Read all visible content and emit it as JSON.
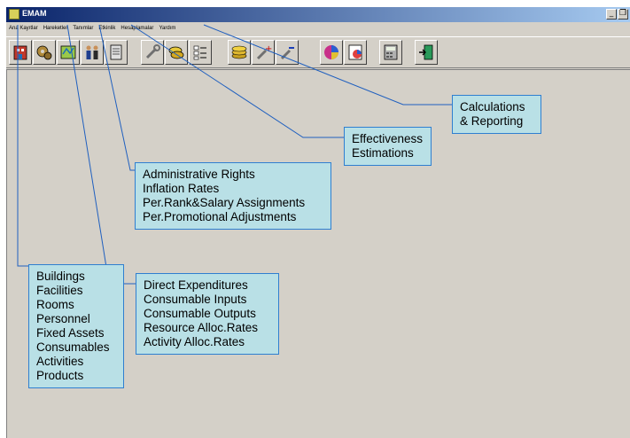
{
  "window": {
    "title": "EMAM",
    "controls": {
      "minimize": "_",
      "restore": "❐"
    }
  },
  "menu": [
    "Ana Kayıtlar",
    "Hareketler",
    "Tanımlar",
    "Etkinlik",
    "Hesaplamalar",
    "Yardım"
  ],
  "toolbar": {
    "icons": [
      "building-icon",
      "gears-icon",
      "map-icon",
      "people-icon",
      "document-icon",
      "wrench-icon",
      "coins-icon",
      "list-icon",
      "money-stack-icon",
      "tools-plus-icon",
      "tools-minus-icon",
      "pie-chart-icon",
      "report-chart-icon",
      "calculator-icon",
      "exit-door-icon"
    ]
  },
  "callouts": {
    "calculations": [
      "Calculations",
      "& Reporting"
    ],
    "effectiveness": [
      "Effectiveness",
      "Estimations"
    ],
    "definitions": [
      "Administrative Rights",
      "Inflation Rates",
      "Per.Rank&Salary Assignments",
      "Per.Promotional Adjustments"
    ],
    "transactions": [
      "Direct Expenditures",
      "Consumable Inputs",
      "Consumable Outputs",
      "Resource Alloc.Rates",
      "Activity Alloc.Rates"
    ],
    "records": [
      "Buildings",
      "Facilities",
      "Rooms",
      "Personnel",
      "Fixed Assets",
      "Consumables",
      "Activities",
      "Products"
    ]
  },
  "colors": {
    "callout_fill": "#b9e0e6",
    "callout_border": "#2f7fd0",
    "connector": "#1f5fbf",
    "titlebar_start": "#0a246a",
    "window_bg": "#d4d0c8"
  }
}
